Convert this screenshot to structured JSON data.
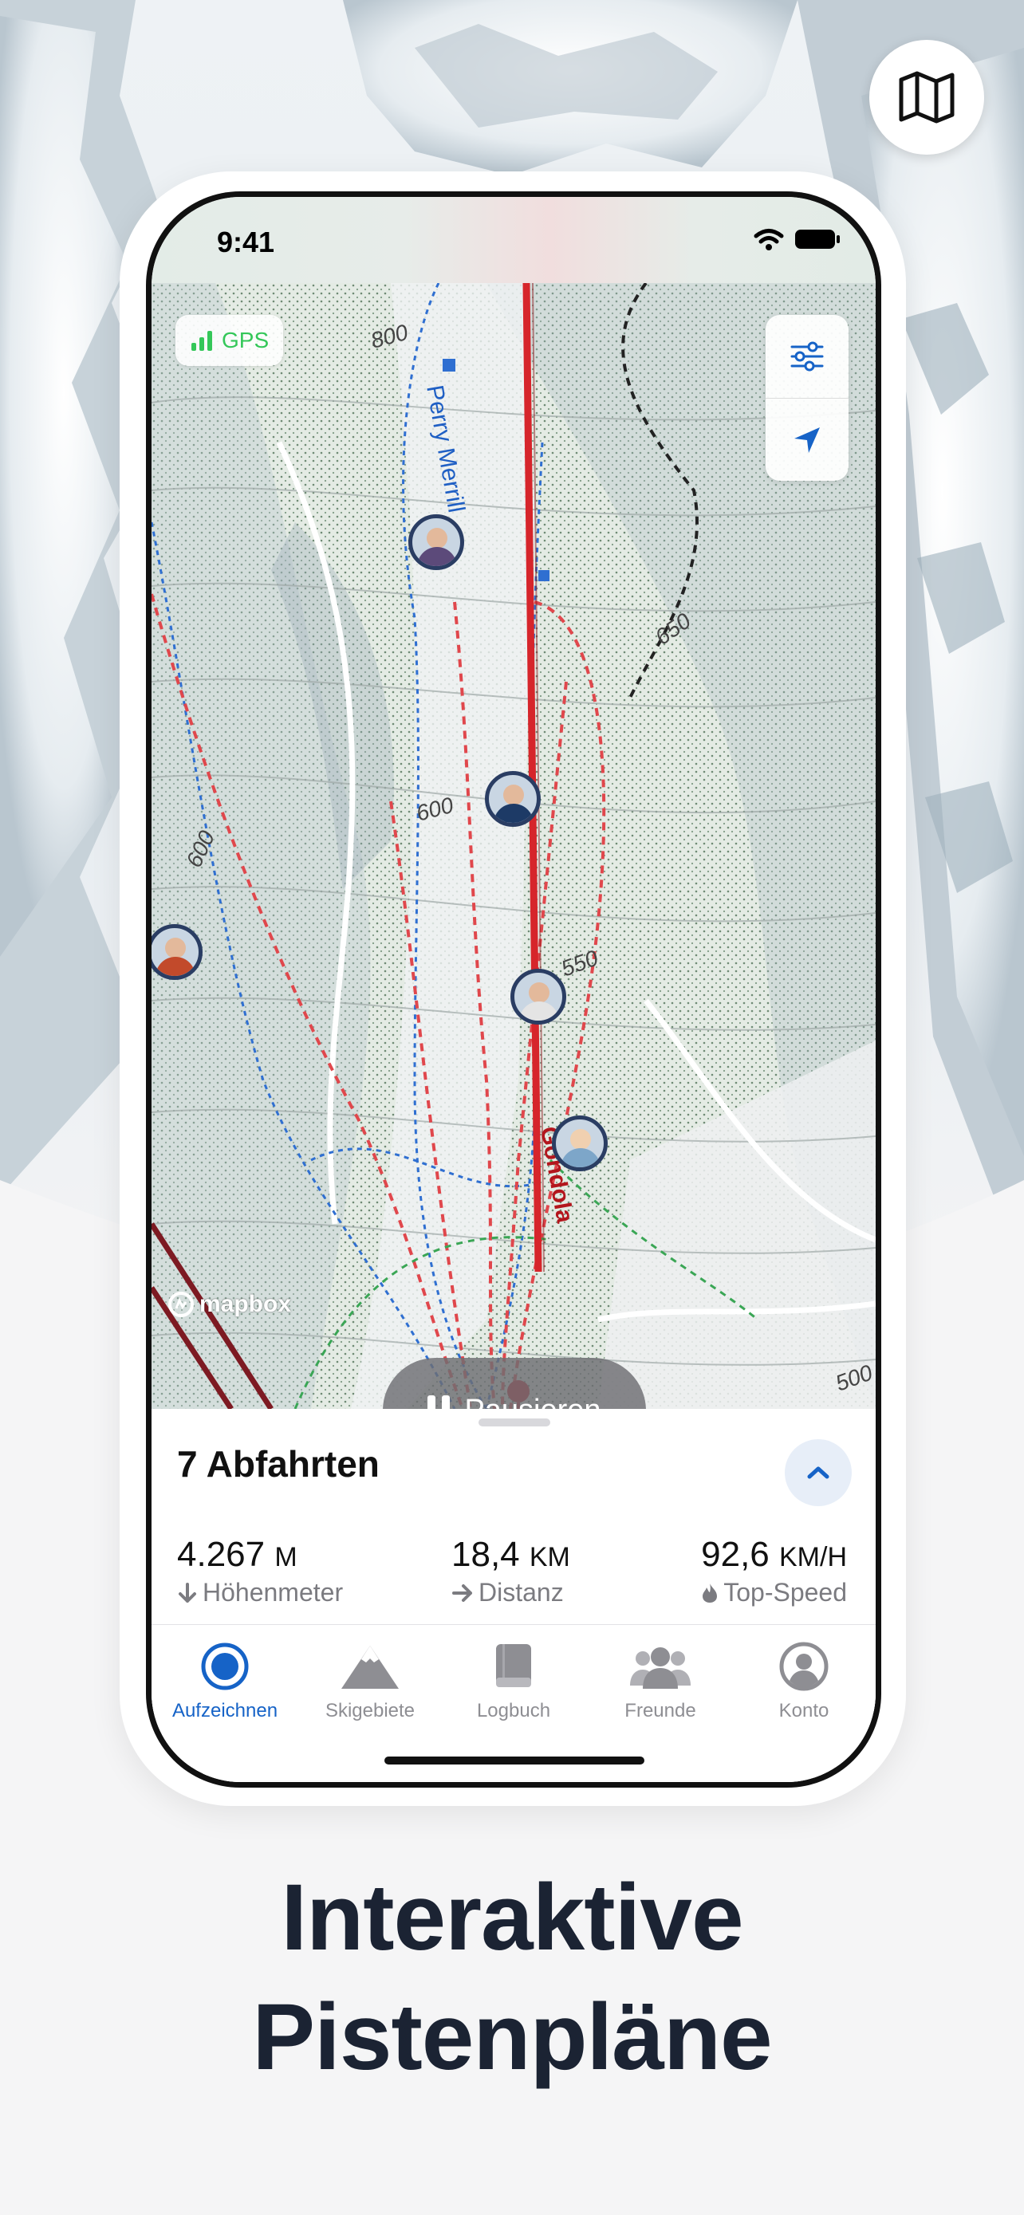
{
  "status_bar": {
    "time": "9:41"
  },
  "map": {
    "gps_label": "GPS",
    "trail_labels": [
      "Perry Merrill",
      "Gondola"
    ],
    "contour_labels": [
      "800",
      "650",
      "600",
      "600",
      "550",
      "500"
    ],
    "attribution": "mapbox",
    "pause_label": "Pausieren"
  },
  "summary": {
    "runs": "7 Abfahrten",
    "stats": [
      {
        "value": "4.267",
        "unit": "M",
        "label": "Höhenmeter",
        "icon": "arrow-down-icon"
      },
      {
        "value": "18,4",
        "unit": "KM",
        "label": "Distanz",
        "icon": "arrow-right-icon"
      },
      {
        "value": "92,6",
        "unit": "KM/H",
        "label": "Top-Speed",
        "icon": "flame-icon"
      }
    ]
  },
  "tabs": [
    {
      "label": "Aufzeichnen",
      "icon": "record-icon",
      "active": true
    },
    {
      "label": "Skigebiete",
      "icon": "mountain-icon",
      "active": false
    },
    {
      "label": "Logbuch",
      "icon": "book-icon",
      "active": false
    },
    {
      "label": "Freunde",
      "icon": "friends-icon",
      "active": false
    },
    {
      "label": "Konto",
      "icon": "account-icon",
      "active": false
    }
  ],
  "headline": {
    "line1": "Interaktive",
    "line2": "Pistenpläne"
  },
  "colors": {
    "accent": "#1663c7",
    "gps_green": "#34c759",
    "lift_red": "#d6252b",
    "headline": "#1b2333"
  }
}
